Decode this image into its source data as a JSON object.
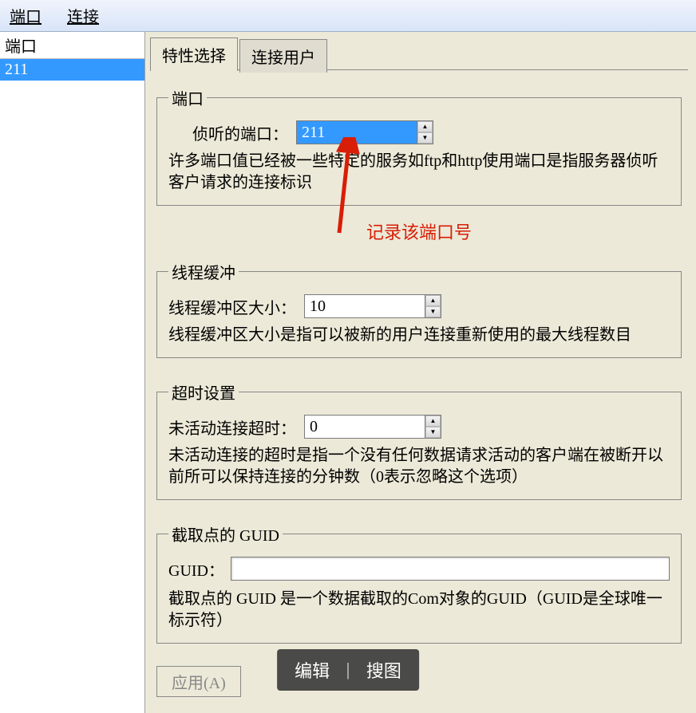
{
  "menu": {
    "port": "端口",
    "connect": "连接"
  },
  "sidebar": {
    "header": "端口",
    "items": [
      "211"
    ]
  },
  "tabs": {
    "properties": "特性选择",
    "users": "连接用户"
  },
  "groups": {
    "port": {
      "legend": "端口",
      "label": "侦听的端口：",
      "value": "211",
      "desc": "许多端口值已经被一些特定的服务如ftp和http使用端口是指服务器侦听客户请求的连接标识"
    },
    "buffer": {
      "legend": "线程缓冲",
      "label": "线程缓冲区大小：",
      "value": "10",
      "desc": "线程缓冲区大小是指可以被新的用户连接重新使用的最大线程数目"
    },
    "timeout": {
      "legend": "超时设置",
      "label": "未活动连接超时：",
      "value": "0",
      "desc": "未活动连接的超时是指一个没有任何数据请求活动的客户端在被断开以前所可以保持连接的分钟数（0表示忽略这个选项）"
    },
    "guid": {
      "legend": "截取点的 GUID",
      "label": "GUID：",
      "value": "",
      "desc": "截取点的 GUID 是一个数据截取的Com对象的GUID（GUID是全球唯一标示符）"
    }
  },
  "annotation": "记录该端口号",
  "apply": "应用(A)",
  "toolbar": {
    "edit": "编辑",
    "search": "搜图"
  }
}
